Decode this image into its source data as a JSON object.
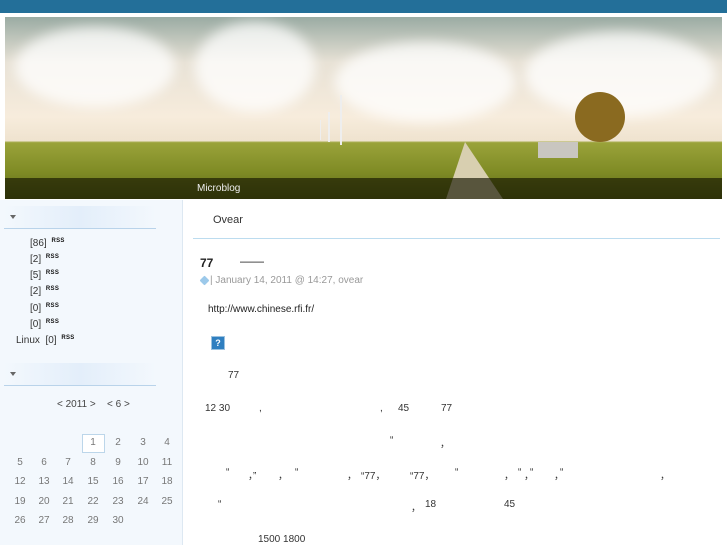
{
  "banner": {
    "caption": "Microblog"
  },
  "sidebar": {
    "categories": [
      {
        "label": "",
        "count": "[86]",
        "rss": "RSS"
      },
      {
        "label": "",
        "count": "[2]",
        "rss": "RSS"
      },
      {
        "label": "",
        "count": "[5]",
        "rss": "RSS"
      },
      {
        "label": "",
        "count": "[2]",
        "rss": "RSS"
      },
      {
        "label": "",
        "count": "[0]",
        "rss": "RSS"
      },
      {
        "label": "",
        "count": "[0]",
        "rss": "RSS"
      },
      {
        "label": "Linux",
        "count": "[0]",
        "rss": "RSS"
      }
    ],
    "calendar": {
      "year_nav": "< 2011 >",
      "month_nav": "< 6 >",
      "selected_day": "1",
      "days": [
        "1",
        "2",
        "3",
        "4",
        "5",
        "6",
        "7",
        "8",
        "9",
        "10",
        "11",
        "12",
        "13",
        "14",
        "15",
        "16",
        "17",
        "18",
        "19",
        "20",
        "21",
        "22",
        "23",
        "24",
        "25",
        "26",
        "27",
        "28",
        "29",
        "30"
      ]
    }
  },
  "main": {
    "author_tab": "Ovear",
    "post": {
      "title": "77",
      "title_dash": "——",
      "meta": "| January 14, 2011 @ 14:27, ovear",
      "link": "http://www.chinese.rfi.fr/",
      "broken_image": "?",
      "fragments": [
        "77",
        "12 30",
        ",",
        ",",
        "45",
        "77",
        "“",
        "，",
        "“",
        "，”",
        "，",
        "“",
        "，",
        "“77，",
        "“77，",
        "“",
        "，",
        "“",
        "，",
        "“",
        "，",
        "“",
        "，",
        "“",
        "，",
        "18",
        "45",
        "1500 1800"
      ]
    }
  },
  "colors": {
    "topbar": "#236f99",
    "accent": "#8fbfe0"
  }
}
